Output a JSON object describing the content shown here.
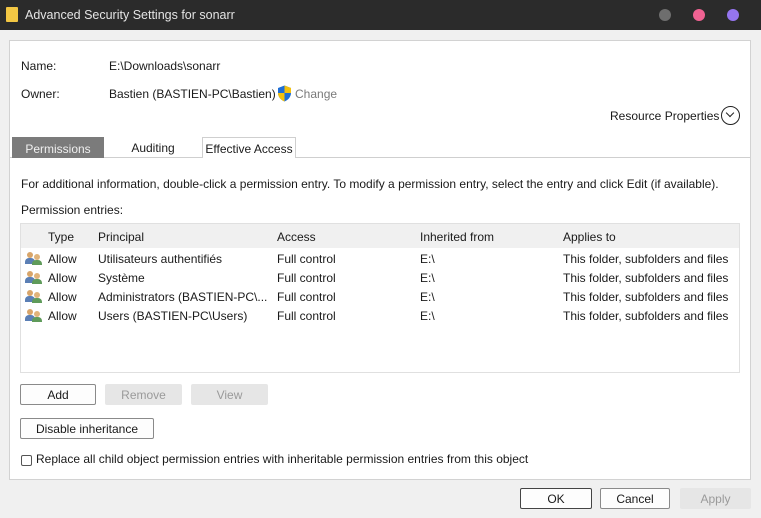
{
  "window": {
    "title": "Advanced Security Settings for sonarr"
  },
  "header": {
    "name_label": "Name:",
    "name_value": "E:\\Downloads\\sonarr",
    "owner_label": "Owner:",
    "owner_value": "Bastien (BASTIEN-PC\\Bastien)",
    "change_label": "Change",
    "resource_properties_label": "Resource Properties"
  },
  "tabs": [
    {
      "label": "Permissions",
      "active": true
    },
    {
      "label": "Auditing",
      "active": false
    },
    {
      "label": "Effective Access",
      "active": false
    }
  ],
  "permissions": {
    "info_text": "For additional information, double-click a permission entry. To modify a permission entry, select the entry and click Edit (if available).",
    "entries_label": "Permission entries:",
    "columns": [
      "Type",
      "Principal",
      "Access",
      "Inherited from",
      "Applies to"
    ],
    "rows": [
      {
        "type": "Allow",
        "principal": "Utilisateurs authentifiés",
        "access": "Full control",
        "inherited_from": "E:\\",
        "applies_to": "This folder, subfolders and files"
      },
      {
        "type": "Allow",
        "principal": "Système",
        "access": "Full control",
        "inherited_from": "E:\\",
        "applies_to": "This folder, subfolders and files"
      },
      {
        "type": "Allow",
        "principal": "Administrators (BASTIEN-PC\\...",
        "access": "Full control",
        "inherited_from": "E:\\",
        "applies_to": "This folder, subfolders and files"
      },
      {
        "type": "Allow",
        "principal": "Users (BASTIEN-PC\\Users)",
        "access": "Full control",
        "inherited_from": "E:\\",
        "applies_to": "This folder, subfolders and files"
      }
    ],
    "add_label": "Add",
    "remove_label": "Remove",
    "view_label": "View",
    "disable_inheritance_label": "Disable inheritance",
    "replace_checkbox_label": "Replace all child object permission entries with inheritable permission entries from this object",
    "replace_checked": false
  },
  "footer": {
    "ok_label": "OK",
    "cancel_label": "Cancel",
    "apply_label": "Apply"
  },
  "icons": {
    "app": "folder-icon",
    "shield": "uac-shield-icon",
    "expand": "chevron-down-circle-icon",
    "principal": "users-group-icon"
  },
  "colors": {
    "titlebar": "#2b2b2b",
    "active_tab": "#7b7b7b",
    "window_dot_gray": "#6e6e6e",
    "window_dot_pink": "#f06292",
    "window_dot_purple": "#9575f0"
  }
}
